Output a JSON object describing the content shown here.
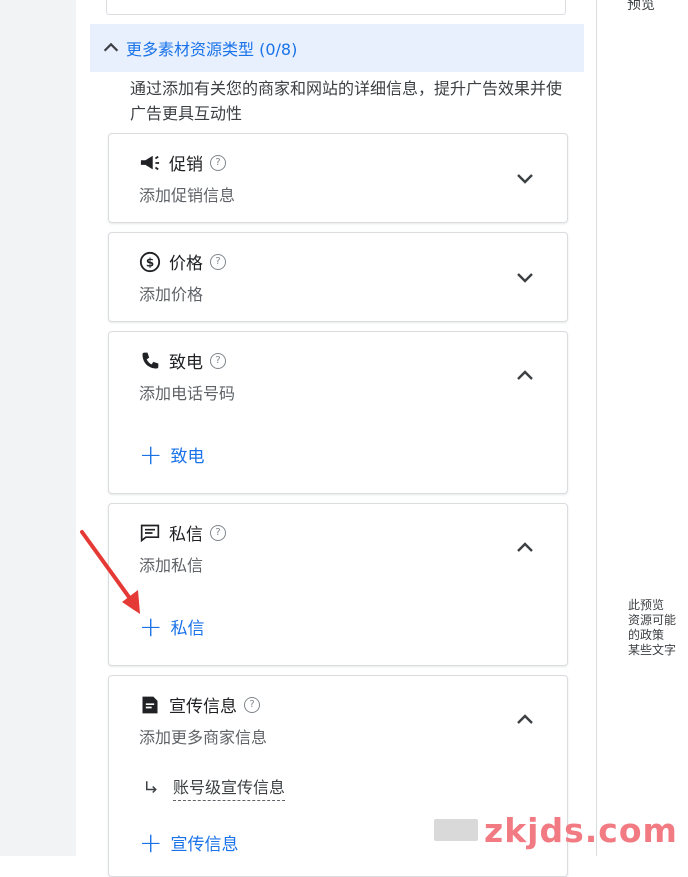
{
  "section": {
    "title": "更多素材资源类型 (0/8)",
    "description": "通过添加有关您的商家和网站的详细信息，提升广告效果并使广告更具互动性"
  },
  "cards": [
    {
      "title": "促销",
      "subtitle": "添加促销信息",
      "icon": "megaphone-icon",
      "expanded": false
    },
    {
      "title": "价格",
      "subtitle": "添加价格",
      "icon": "price-icon",
      "expanded": false
    },
    {
      "title": "致电",
      "subtitle": "添加电话号码",
      "icon": "phone-icon",
      "expanded": true,
      "add_label": "致电"
    },
    {
      "title": "私信",
      "subtitle": "添加私信",
      "icon": "message-icon",
      "expanded": true,
      "add_label": "私信"
    },
    {
      "title": "宣传信息",
      "subtitle": "添加更多商家信息",
      "icon": "callout-icon",
      "expanded": true,
      "sub_link": "账号级宣传信息",
      "add_label": "宣传信息"
    }
  ],
  "right_panel": {
    "top_text": "预览",
    "note_lines": [
      "此预览",
      "资源可能",
      "的政策",
      "某些文字"
    ]
  },
  "watermark": "zkjds.com",
  "colors": {
    "accent": "#1a73e8",
    "header_bg": "#e8f0fe",
    "annotation_arrow": "#e53935"
  }
}
